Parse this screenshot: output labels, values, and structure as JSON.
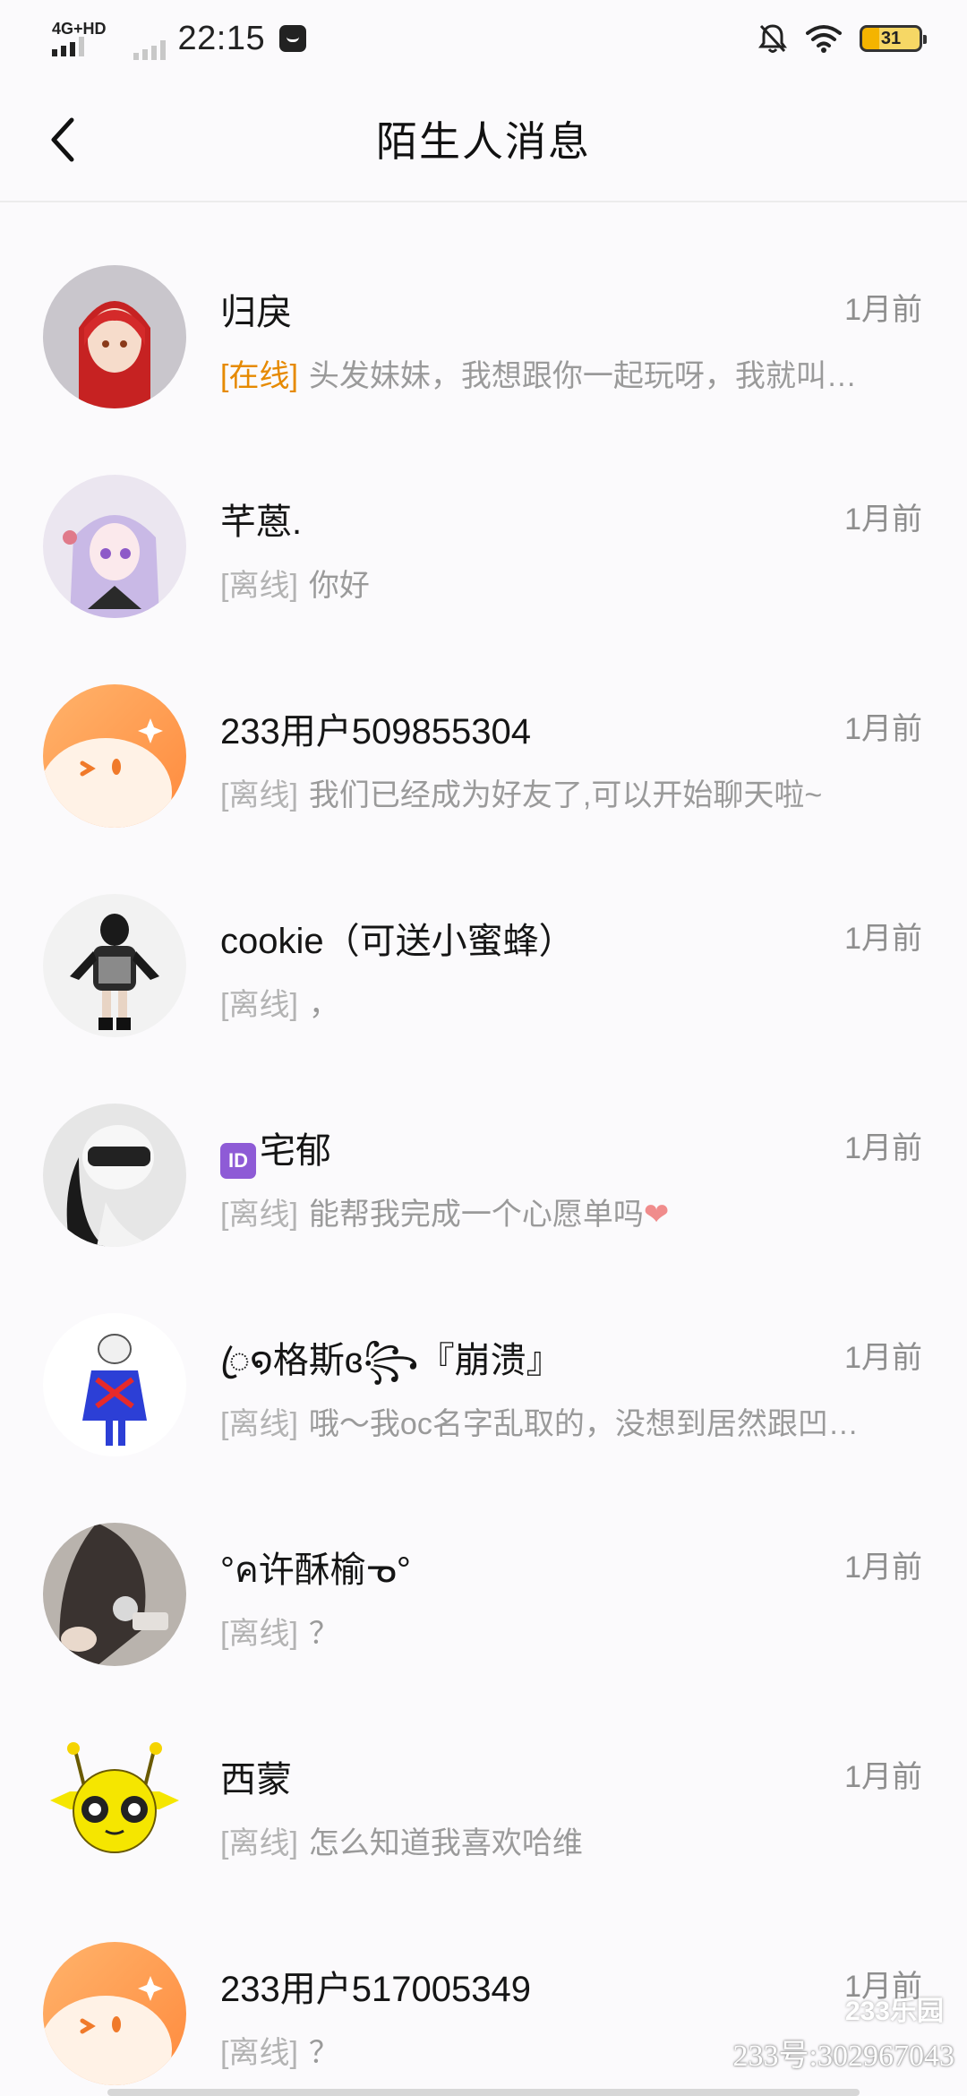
{
  "status_bar": {
    "network": "4G+HD",
    "time": "22:15",
    "battery": "31",
    "icons": [
      "message-icon",
      "bell-mute-icon",
      "wifi-icon",
      "battery-icon"
    ]
  },
  "header": {
    "title": "陌生人消息",
    "back_icon": "chevron-left-icon"
  },
  "conversations": [
    {
      "name": "归戾",
      "time": "1月前",
      "status": "[在线]",
      "online": true,
      "preview": "头发妹妹，我想跟你一起玩呀，我就叫…"
    },
    {
      "name": "芊蒽.",
      "time": "1月前",
      "status": "[离线]",
      "online": false,
      "preview": "你好"
    },
    {
      "name": "233用户509855304",
      "time": "1月前",
      "status": "[离线]",
      "online": false,
      "preview": "我们已经成为好友了,可以开始聊天啦~"
    },
    {
      "name": "cookie（可送小蜜蜂）",
      "time": "1月前",
      "status": "[离线]",
      "online": false,
      "preview": "，"
    },
    {
      "badge": "ID",
      "name": "宅郁",
      "time": "1月前",
      "status": "[离线]",
      "online": false,
      "preview": "能帮我完成一个心愿单吗",
      "preview_emoji": "❤"
    },
    {
      "name": "ꦿ໑格斯ɞ꧂『崩溃』",
      "time": "1月前",
      "status": "[离线]",
      "online": false,
      "preview": "哦〜我oc名字乱取的，没想到居然跟凹…"
    },
    {
      "name": "°ค许酥榆ᓀ°",
      "time": "1月前",
      "status": "[离线]",
      "online": false,
      "preview": "？"
    },
    {
      "name": "西蒙",
      "time": "1月前",
      "status": "[离线]",
      "online": false,
      "preview": "怎么知道我喜欢哈维"
    },
    {
      "name": "233用户517005349",
      "time": "1月前",
      "status": "[离线]",
      "online": false,
      "preview": "？"
    }
  ],
  "watermark": {
    "logo": "233乐园",
    "text": "233号:302967043"
  },
  "colors": {
    "online": "#e68a00",
    "offline": "#b3b3b3",
    "background": "#fbfafc"
  }
}
